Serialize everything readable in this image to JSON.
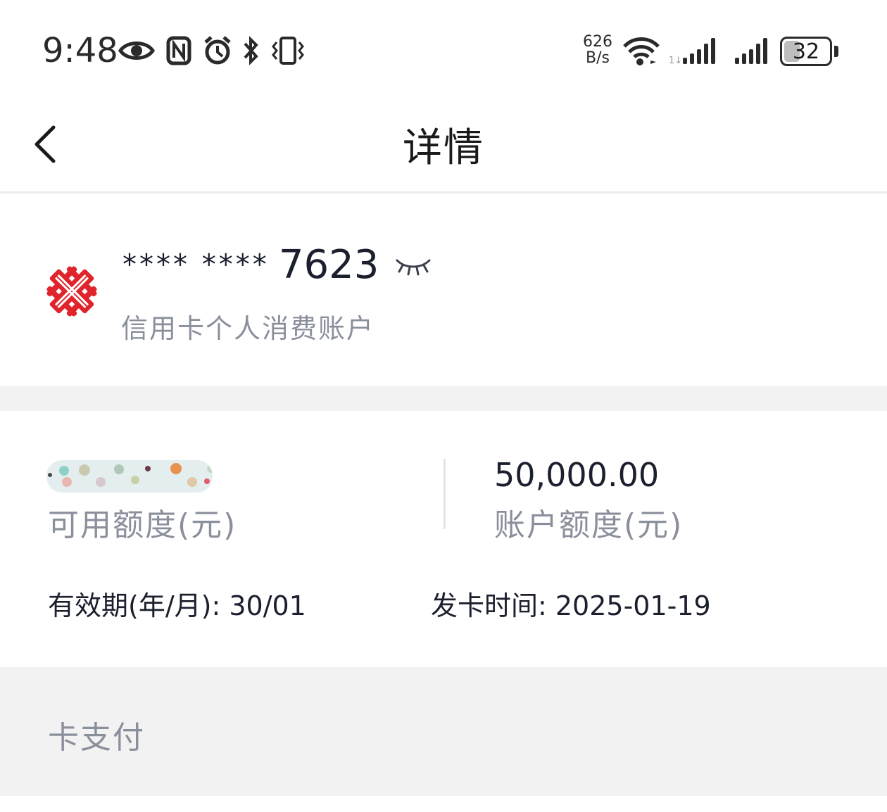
{
  "status_bar": {
    "time": "9:48",
    "net_speed_value": "626",
    "net_speed_unit": "B/s",
    "battery": "32",
    "icons": [
      "eye-icon",
      "nfc-icon",
      "alarm-icon",
      "bluetooth-icon",
      "vibrate-icon",
      "wifi-icon",
      "signal-icon",
      "signal-icon",
      "battery-icon"
    ]
  },
  "nav": {
    "title": "详情",
    "back_icon": "chevron-left-icon"
  },
  "card": {
    "masked_prefix": "**** ****",
    "last4": "7623",
    "account_type": "信用卡个人消费账户",
    "logo_icon": "bank-logo",
    "visibility_icon": "eye-closed-icon",
    "brand_color": "#e0242c"
  },
  "credit": {
    "available_label": "可用额度(元)",
    "limit_amount": "50,000.00",
    "limit_label": "账户额度(元)",
    "expiry": "有效期(年/月): 30/01",
    "issue_date": "发卡时间: 2025-01-19"
  },
  "payment": {
    "section_label": "卡支付"
  }
}
